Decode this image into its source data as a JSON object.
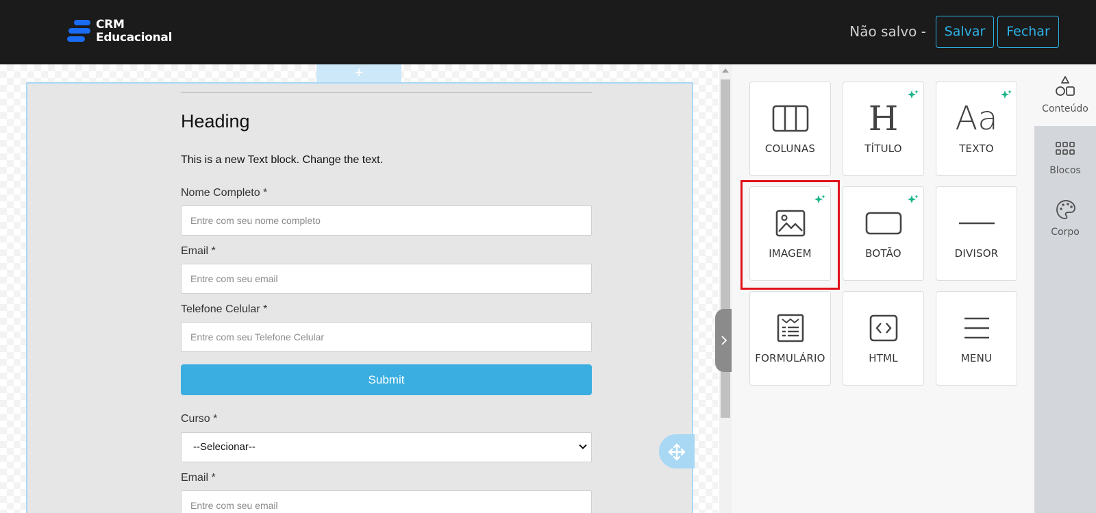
{
  "header": {
    "brand_line1": "CRM",
    "brand_line2": "Educacional",
    "status": "Não salvo -",
    "save_label": "Salvar",
    "close_label": "Fechar",
    "accent_color": "#2db3e8"
  },
  "canvas": {
    "add_row": "+",
    "heading": "Heading",
    "text_block": "This is a new Text block. Change the text.",
    "fields": [
      {
        "label": "Nome Completo *",
        "placeholder": "Entre com seu nome completo"
      },
      {
        "label": "Email *",
        "placeholder": "Entre com seu email"
      },
      {
        "label": "Telefone Celular *",
        "placeholder": "Entre com seu Telefone Celular"
      }
    ],
    "submit_label": "Submit",
    "course_label": "Curso *",
    "course_selected": "--Selecionar--",
    "email2_label": "Email *",
    "email2_placeholder": "Entre com seu email",
    "submit_color": "#3aaee0"
  },
  "content_tiles": [
    {
      "label": "COLUNAS",
      "icon": "columns-icon",
      "ai": false
    },
    {
      "label": "TÍTULO",
      "icon": "heading-icon",
      "glyph": "H",
      "ai": true
    },
    {
      "label": "TEXTO",
      "icon": "text-icon",
      "glyph": "Aa",
      "ai": true
    },
    {
      "label": "IMAGEM",
      "icon": "image-icon",
      "ai": true,
      "highlighted": true
    },
    {
      "label": "BOTÃO",
      "icon": "button-icon",
      "ai": true
    },
    {
      "label": "DIVISOR",
      "icon": "divider-icon",
      "ai": false
    },
    {
      "label": "FORMULÁRIO",
      "icon": "form-icon",
      "ai": false
    },
    {
      "label": "HTML",
      "icon": "html-icon",
      "ai": false
    },
    {
      "label": "MENU",
      "icon": "menu-icon",
      "ai": false
    }
  ],
  "side_tabs": [
    {
      "label": "Conteúdo",
      "icon": "shapes-icon",
      "active": true
    },
    {
      "label": "Blocos",
      "icon": "grid-icon",
      "active": false
    },
    {
      "label": "Corpo",
      "icon": "palette-icon",
      "active": false
    }
  ],
  "highlight_color": "#e0101a",
  "ai_spark_color": "#1bb58a"
}
